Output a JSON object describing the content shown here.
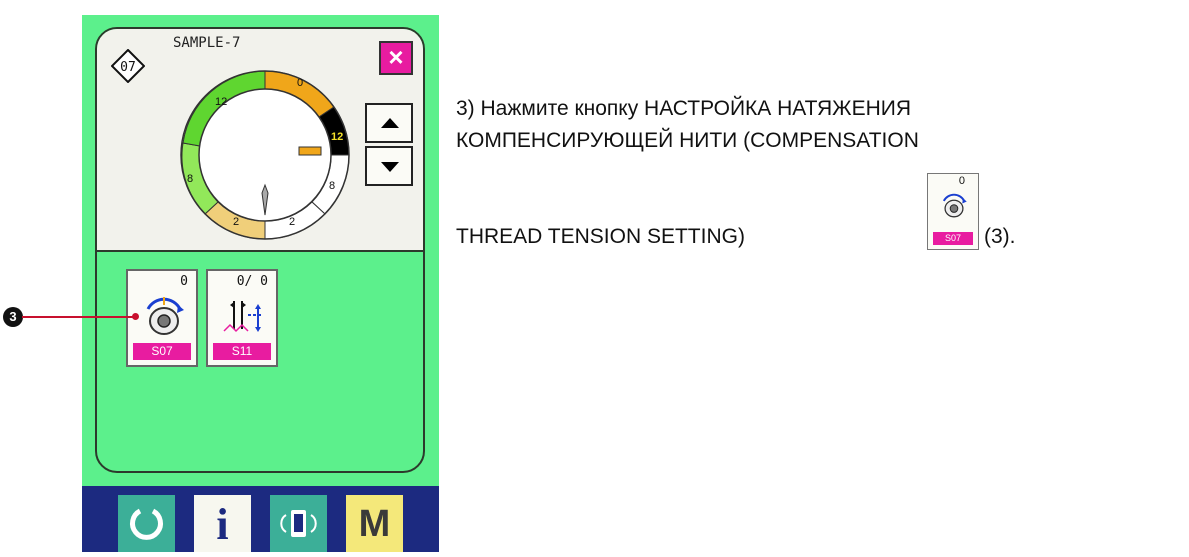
{
  "panel": {
    "pattern_no": "07",
    "pattern_name": "SAMPLE-7",
    "close_label": "×",
    "dial_values": [
      "0",
      "12",
      "8",
      "2",
      "2",
      "8",
      "12"
    ],
    "colors": {
      "background": "#5cf08c",
      "accent": "#e81ca0",
      "orange": "#f0a61a",
      "green": "#5fd630",
      "light_green": "#92e85a",
      "tan": "#f0cf7a",
      "black_segment": "#000000"
    },
    "buttons": [
      {
        "value": "0",
        "code": "S07",
        "icon": "compensation-tension-icon"
      },
      {
        "value": "0/  0",
        "code": "S11",
        "icon": "stitch-setting-icon"
      }
    ]
  },
  "bottom_bar": {
    "info_label": "i",
    "mode_label": "M",
    "icons": [
      "reset-icon",
      "info-icon",
      "communication-icon",
      "mode-icon"
    ]
  },
  "callout": {
    "number": "3"
  },
  "instruction": {
    "line1": "3) Нажмите кнопку НАСТРОЙКА НАТЯЖЕНИЯ",
    "line2": "КОМПЕНСИРУЮЩЕЙ НИТИ (COMPENSATION",
    "line3": "THREAD TENSION SETTING)",
    "after_button": "(3).",
    "button_value": "0",
    "button_code": "S07"
  }
}
